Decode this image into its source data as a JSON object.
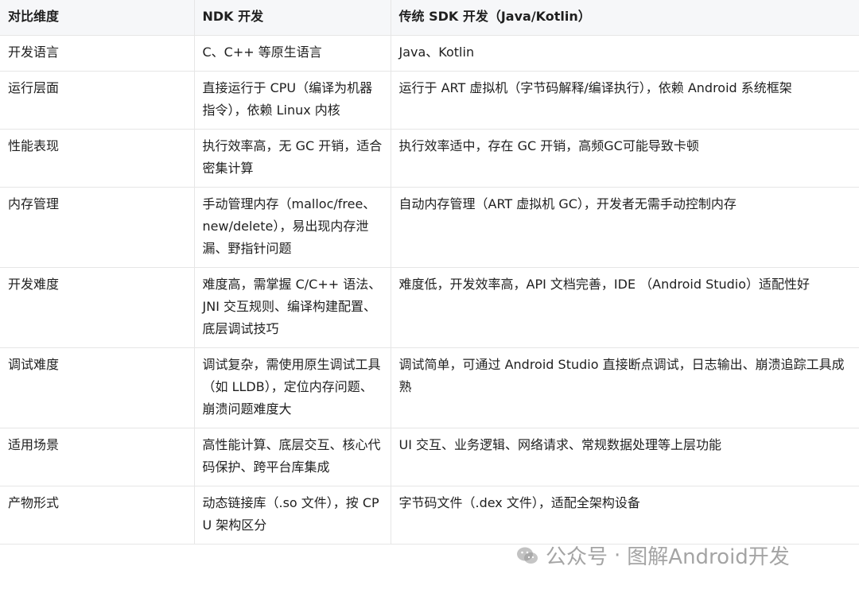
{
  "table": {
    "headers": [
      "对比维度",
      "NDK 开发",
      "传统 SDK 开发（Java/Kotlin）"
    ],
    "rows": [
      [
        "开发语言",
        "C、C++ 等原生语言",
        "Java、Kotlin"
      ],
      [
        "运行层面",
        "直接运行于 CPU（编译为机器指令），依赖 Linux 内核",
        "运行于 ART 虚拟机（字节码解释/编译执行），依赖 Android 系统框架"
      ],
      [
        "性能表现",
        "执行效率高，无 GC 开销，适合密集计算",
        "执行效率适中，存在 GC 开销，高频GC可能导致卡顿"
      ],
      [
        "内存管理",
        "手动管理内存（malloc/free、new/delete），易出现内存泄漏、野指针问题",
        "自动内存管理（ART 虚拟机 GC），开发者无需手动控制内存"
      ],
      [
        "开发难度",
        "难度高，需掌握 C/C++ 语法、JNI 交互规则、编译构建配置、底层调试技巧",
        "难度低，开发效率高，API 文档完善，IDE （Android Studio）适配性好"
      ],
      [
        "调试难度",
        "调试复杂，需使用原生调试工具（如 LLDB），定位内存问题、崩溃问题难度大",
        "调试简单，可通过 Android Studio 直接断点调试，日志输出、崩溃追踪工具成熟"
      ],
      [
        "适用场景",
        "高性能计算、底层交互、核心代码保护、跨平台库集成",
        "UI 交互、业务逻辑、网络请求、常规数据处理等上层功能"
      ],
      [
        "产物形式",
        "动态链接库（.so 文件），按 CPU 架构区分",
        "字节码文件（.dex 文件），适配全架构设备"
      ]
    ]
  },
  "watermark": {
    "prefix": "公众号",
    "name": "图解Android开发",
    "icon": "wechat-icon",
    "color": "#8a8a8a"
  }
}
